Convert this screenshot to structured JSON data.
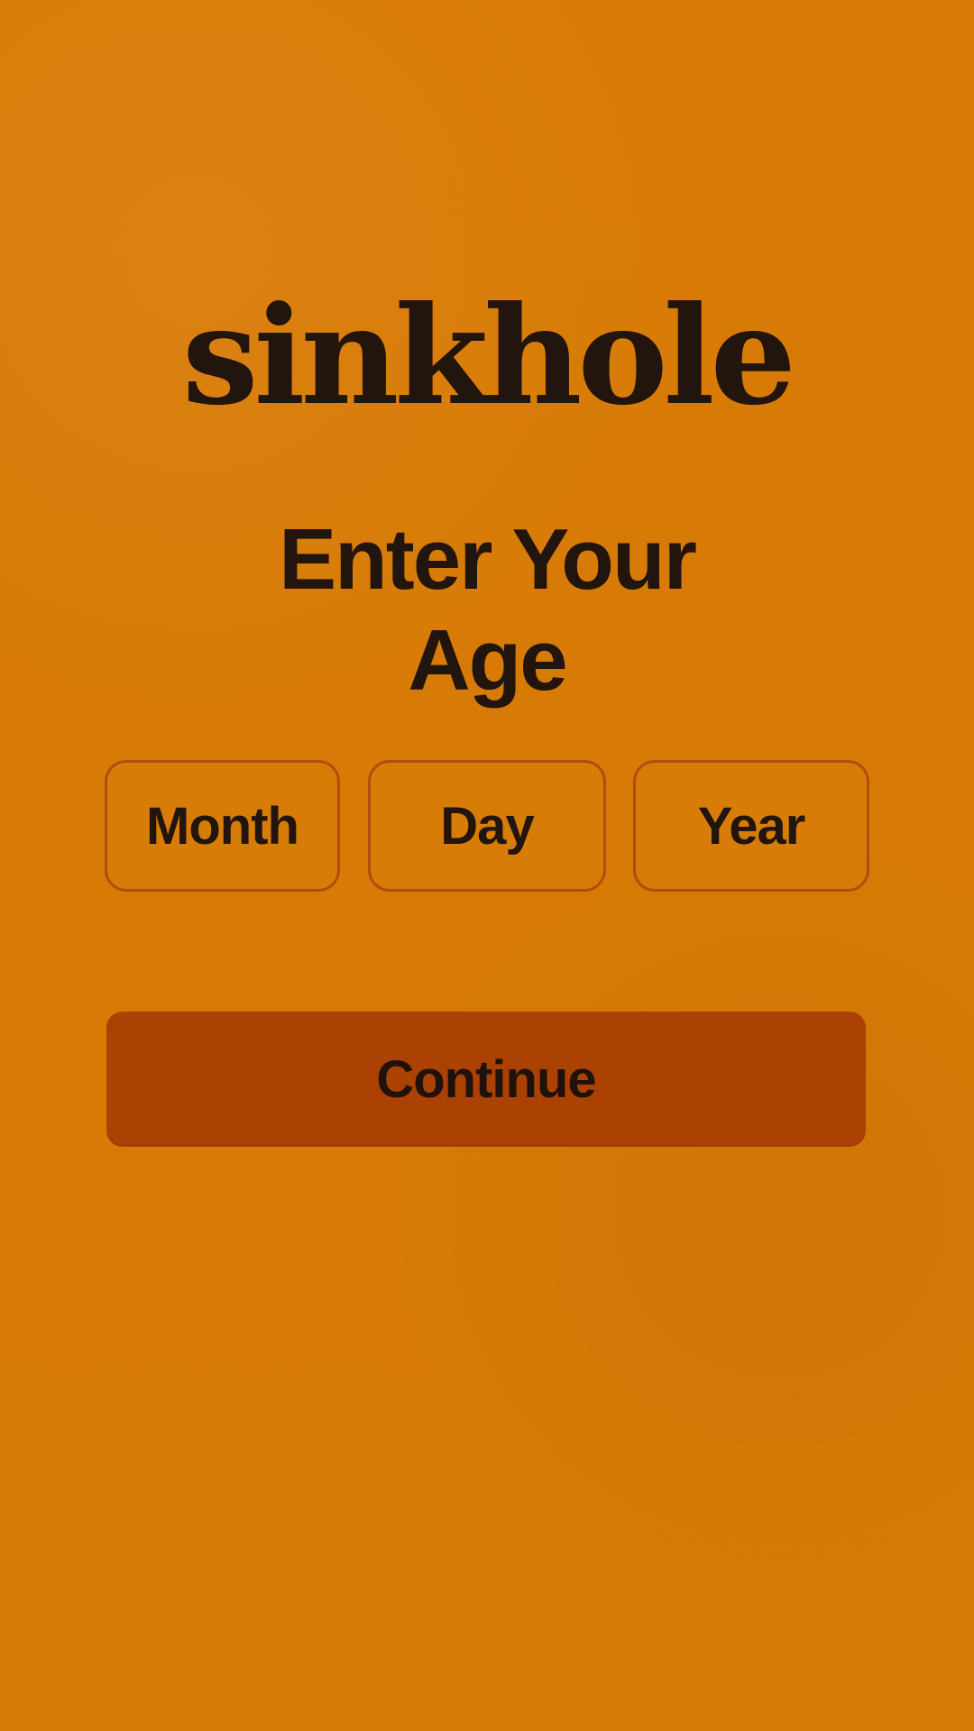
{
  "app": {
    "name": "sinkhole"
  },
  "screen": {
    "title_line_1": "Enter Your",
    "title_line_2": "Age"
  },
  "date_fields": {
    "month": "Month",
    "day": "Day",
    "year": "Year"
  },
  "actions": {
    "continue": "Continue"
  },
  "colors": {
    "background": "#d97b06",
    "field_border": "#b14e0d",
    "button_background": "#ab4204",
    "text": "#22150e"
  }
}
